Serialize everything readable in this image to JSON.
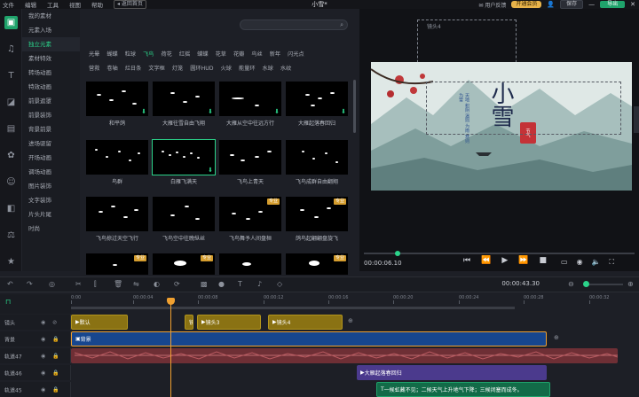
{
  "menubar": {
    "items": [
      "文件",
      "编辑",
      "工具",
      "视图",
      "帮助"
    ],
    "back_home": "返回首页",
    "title": "小雪*",
    "user_feedback": "用户反馈",
    "upgrade": "开通会员",
    "save": "保存",
    "export": "导出"
  },
  "left_rail": {
    "icons": [
      "media-icon",
      "music-icon",
      "text-icon",
      "effects-icon",
      "frames-icon",
      "sticker-icon",
      "person-icon",
      "layers-icon",
      "filter-icon",
      "star-icon"
    ]
  },
  "categories": [
    "我的素材",
    "元素入场",
    "独立元素",
    "素材特效",
    "转场动画",
    "特效动画",
    "前景遮罩",
    "前景装饰",
    "背景前景",
    "进场驱留",
    "开场动画",
    "调场动画",
    "图片装饰",
    "文字装饰",
    "片头片尾",
    "时尚"
  ],
  "active_category": "独立元素",
  "filters": {
    "row1": [
      "光晕",
      "蝴蝶",
      "粒球",
      "飞鸟",
      "荷花",
      "红摇",
      "蝶蝶",
      "花草",
      "花瓣",
      "鸟丝",
      "新年",
      "闪光点"
    ],
    "row2": [
      "营救",
      "卷轴",
      "烂日条",
      "文字框",
      "灯笼",
      "圆环HUD",
      "火球",
      "能量环",
      "水球",
      "水纹"
    ],
    "active": "飞鸟"
  },
  "materials": [
    {
      "label": "和平鸽",
      "badge": "",
      "download": true
    },
    {
      "label": "大雁往雪自由飞翔",
      "badge": "",
      "download": true
    },
    {
      "label": "大雁从空中往远方行",
      "badge": "",
      "download": true
    },
    {
      "label": "大雁起落春回归",
      "badge": "",
      "download": true
    },
    {
      "label": "鸟群",
      "badge": "",
      "download": false
    },
    {
      "label": "白雁飞满天",
      "badge": "",
      "download": true
    },
    {
      "label": "飞鸟上青天",
      "badge": "",
      "download": false
    },
    {
      "label": "飞鸟成群自由翻翔",
      "badge": "",
      "download": false
    },
    {
      "label": "飞鸟掠过天空飞行",
      "badge": "",
      "download": false
    },
    {
      "label": "飞鸟空中往晚纵丝",
      "badge": "",
      "download": false
    },
    {
      "label": "飞鸟舞予人间盘桓",
      "badge": "专业",
      "download": false
    },
    {
      "label": "鸽鸟起翩翩盘旋飞",
      "badge": "专业",
      "download": false
    },
    {
      "label": "",
      "badge": "专业",
      "download": false
    },
    {
      "label": "",
      "badge": "专业",
      "download": false
    },
    {
      "label": "",
      "badge": "",
      "download": false
    },
    {
      "label": "",
      "badge": "专业",
      "download": false
    }
  ],
  "preview": {
    "layer_label": "镜头4",
    "title_big": "小雪",
    "stamp": "节气",
    "poem": "天地 积阴 温则 为雨 寒则 为雪",
    "time": "00:00:06.10"
  },
  "timeline": {
    "total_time": "00:00:43.30",
    "ruler": [
      "0:00",
      "00:00:04",
      "00:00:08",
      "00:00:12",
      "00:00:16",
      "00:00:20",
      "00:00:24",
      "00:00:28",
      "00:00:32"
    ],
    "tracks": [
      {
        "name": "镜头",
        "clips": [
          {
            "label": "默认",
            "kind": "gold"
          },
          {
            "label": "镜",
            "kind": "gold"
          },
          {
            "label": "镜头3",
            "kind": "gold"
          },
          {
            "label": "镜头4",
            "kind": "gold"
          }
        ]
      },
      {
        "name": "背景",
        "clips": [
          {
            "label": "背景",
            "kind": "blue"
          }
        ]
      },
      {
        "name": "轨道47",
        "clips": [
          {
            "label": "",
            "kind": "wave"
          }
        ]
      },
      {
        "name": "轨道46",
        "clips": [
          {
            "label": "大雁起落春回归",
            "kind": "purple"
          }
        ]
      },
      {
        "name": "轨道45",
        "clips": [
          {
            "label": "一候虹藏不见；二候天气上升地气下降；三候闭塞而成冬。",
            "kind": "green"
          }
        ]
      }
    ]
  },
  "colors": {
    "accent": "#2bd38a",
    "gold": "#e8b34a",
    "clip_blue": "#17468e",
    "clip_gold": "#8a7213",
    "clip_purple": "#4b3a8d"
  }
}
